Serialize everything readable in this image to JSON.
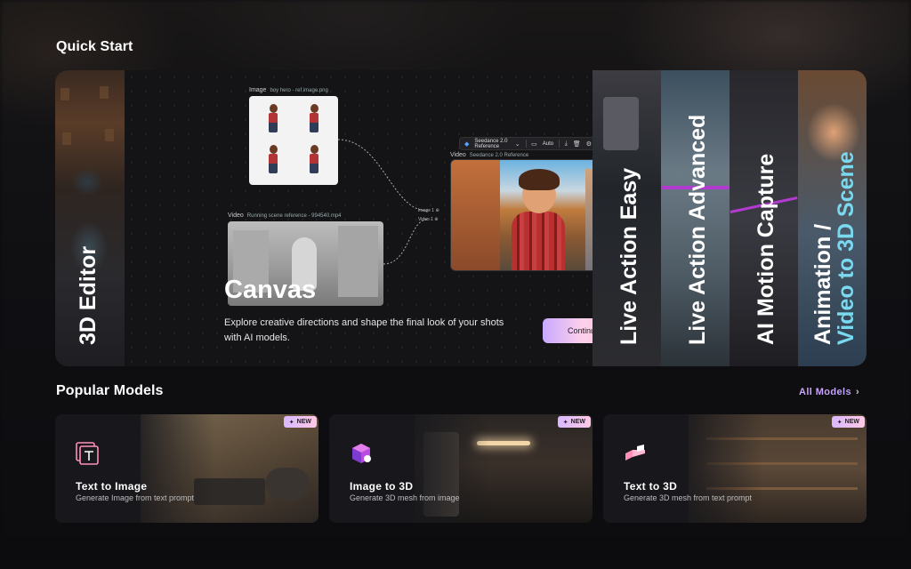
{
  "quick_start": {
    "title": "Quick Start",
    "editor_3d": {
      "label": "3D Editor"
    },
    "canvas": {
      "title": "Canvas",
      "description": "Explore creative directions and shape the final look of your shots with AI models.",
      "continue_label": "Continue",
      "image_node": {
        "type": "Image",
        "name": "boy hero - ref image.png"
      },
      "video_node": {
        "type": "Video",
        "name": "Running scene reference - 994540.mp4"
      },
      "reference_node": {
        "type": "Video",
        "name": "Seedance 2.0 Reference"
      },
      "ports": {
        "image": "Image 1 ⊕",
        "video": "Video 1 ⊕"
      },
      "toolbar": {
        "model": "Seedance 2.0 Reference",
        "aspect": "Auto"
      }
    },
    "features": [
      {
        "line1": "Live Action Easy"
      },
      {
        "line1": "Live Action Advanced"
      },
      {
        "line1": "AI Motion Capture"
      },
      {
        "line1": "Animation /",
        "line2": "Video to 3D Scene"
      }
    ]
  },
  "popular_models": {
    "title": "Popular Models",
    "all_models_label": "All Models",
    "cards": [
      {
        "badge": "NEW",
        "title": "Text to Image",
        "subtitle": "Generate Image from text prompt",
        "icon": "text-image-icon"
      },
      {
        "badge": "NEW",
        "title": "Image to 3D",
        "subtitle": "Generate 3D mesh from image",
        "icon": "cube-icon"
      },
      {
        "badge": "NEW",
        "title": "Text to 3D",
        "subtitle": "Generate 3D mesh from text prompt",
        "icon": "blocks-icon"
      }
    ]
  },
  "colors": {
    "accent_gradient_start": "#c8a9ff",
    "accent_gradient_end": "#ffb0d0",
    "highlight_cyan": "#7ad9ef"
  }
}
